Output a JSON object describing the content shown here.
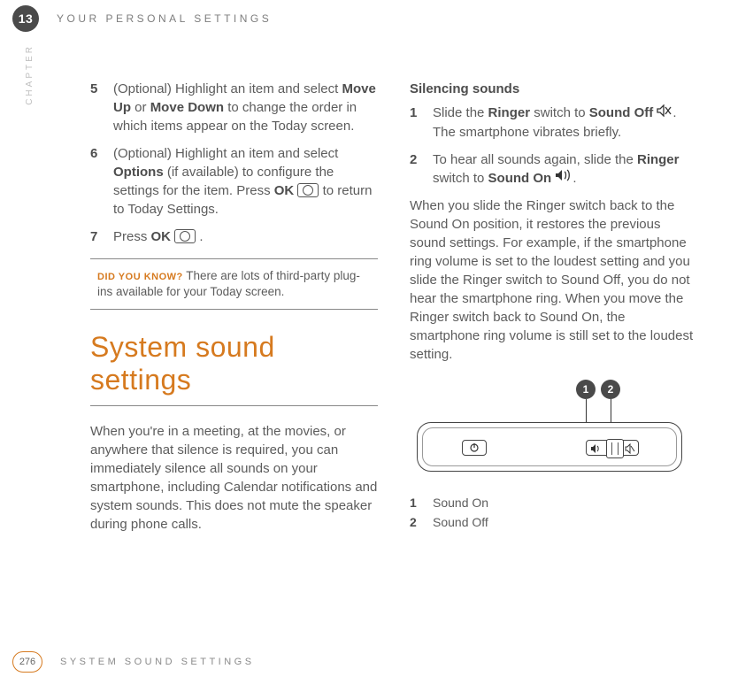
{
  "chapter": {
    "number": "13",
    "label": "CHAPTER",
    "title": "YOUR PERSONAL SETTINGS"
  },
  "left": {
    "steps": [
      {
        "n": "5",
        "pre": "(Optional) Highlight an item and select ",
        "b1": "Move Up",
        "mid": " or ",
        "b2": "Move Down",
        "post": " to change the order in which items appear on the Today screen."
      },
      {
        "n": "6",
        "pre": "(Optional) Highlight an item and select ",
        "b1": "Options",
        "mid": " (if available) to configure the settings for the item. Press ",
        "b2": "OK",
        "post": " to return to Today Settings."
      },
      {
        "n": "7",
        "pre": "Press ",
        "b1": "OK",
        "post": " ."
      }
    ],
    "callout": {
      "label": "DID YOU KNOW?",
      "text": " There are lots of third-party plug-ins available for your Today screen."
    },
    "section_title": "System sound settings",
    "intro": "When you're in a meeting, at the movies, or anywhere that silence is required, you can immediately silence all sounds on your smartphone, including Calendar notifications and system sounds. This does not mute the speaker during phone calls."
  },
  "right": {
    "subhead": "Silencing sounds",
    "steps": [
      {
        "n": "1",
        "pre": "Slide the ",
        "b1": "Ringer",
        "mid": " switch to ",
        "b2": "Sound Off",
        "post": ". The smartphone vibrates briefly.",
        "icon": "sound-off"
      },
      {
        "n": "2",
        "pre": "To hear all sounds again, slide the ",
        "b1": "Ringer",
        "mid": " switch to ",
        "b2": "Sound On",
        "post": ".",
        "icon": "sound-on"
      }
    ],
    "para": "When you slide the Ringer switch back to the Sound On position, it restores the previous sound settings. For example, if the smartphone ring volume is set to the loudest setting and you slide the Ringer switch to Sound Off, you do not hear the smartphone ring. When you move the Ringer switch back to Sound On, the smartphone ring volume is still set to the loudest setting.",
    "legend": [
      {
        "n": "1",
        "t": "Sound On"
      },
      {
        "n": "2",
        "t": "Sound Off"
      }
    ]
  },
  "footer": {
    "page": "276",
    "title": "SYSTEM SOUND SETTINGS"
  }
}
